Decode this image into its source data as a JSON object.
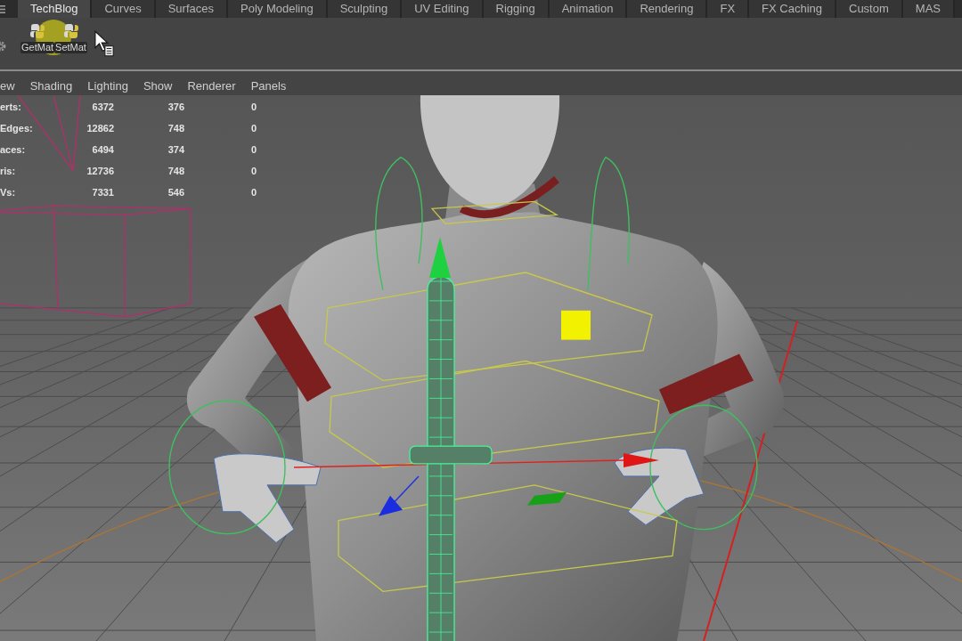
{
  "shelf_tabs": [
    {
      "label": "TechBlog",
      "selected": true
    },
    {
      "label": "Curves",
      "selected": false
    },
    {
      "label": "Surfaces",
      "selected": false
    },
    {
      "label": "Poly Modeling",
      "selected": false
    },
    {
      "label": "Sculpting",
      "selected": false
    },
    {
      "label": "UV Editing",
      "selected": false
    },
    {
      "label": "Rigging",
      "selected": false
    },
    {
      "label": "Animation",
      "selected": false
    },
    {
      "label": "Rendering",
      "selected": false
    },
    {
      "label": "FX",
      "selected": false
    },
    {
      "label": "FX Caching",
      "selected": false
    },
    {
      "label": "Custom",
      "selected": false
    },
    {
      "label": "MAS",
      "selected": false
    }
  ],
  "shelf": {
    "buttons": [
      {
        "label": "GetMat"
      },
      {
        "label": "SetMat"
      }
    ]
  },
  "panel_menu": [
    "ew",
    "Shading",
    "Lighting",
    "Show",
    "Renderer",
    "Panels"
  ],
  "hud_stats": [
    {
      "label": "erts:",
      "values": [
        "6372",
        "376",
        "0"
      ]
    },
    {
      "label": "Edges:",
      "values": [
        "12862",
        "748",
        "0"
      ]
    },
    {
      "label": "aces:",
      "values": [
        "6494",
        "374",
        "0"
      ]
    },
    {
      "label": "ris:",
      "values": [
        "12736",
        "748",
        "0"
      ]
    },
    {
      "label": "Vs:",
      "values": [
        "7331",
        "546",
        "0"
      ]
    }
  ]
}
